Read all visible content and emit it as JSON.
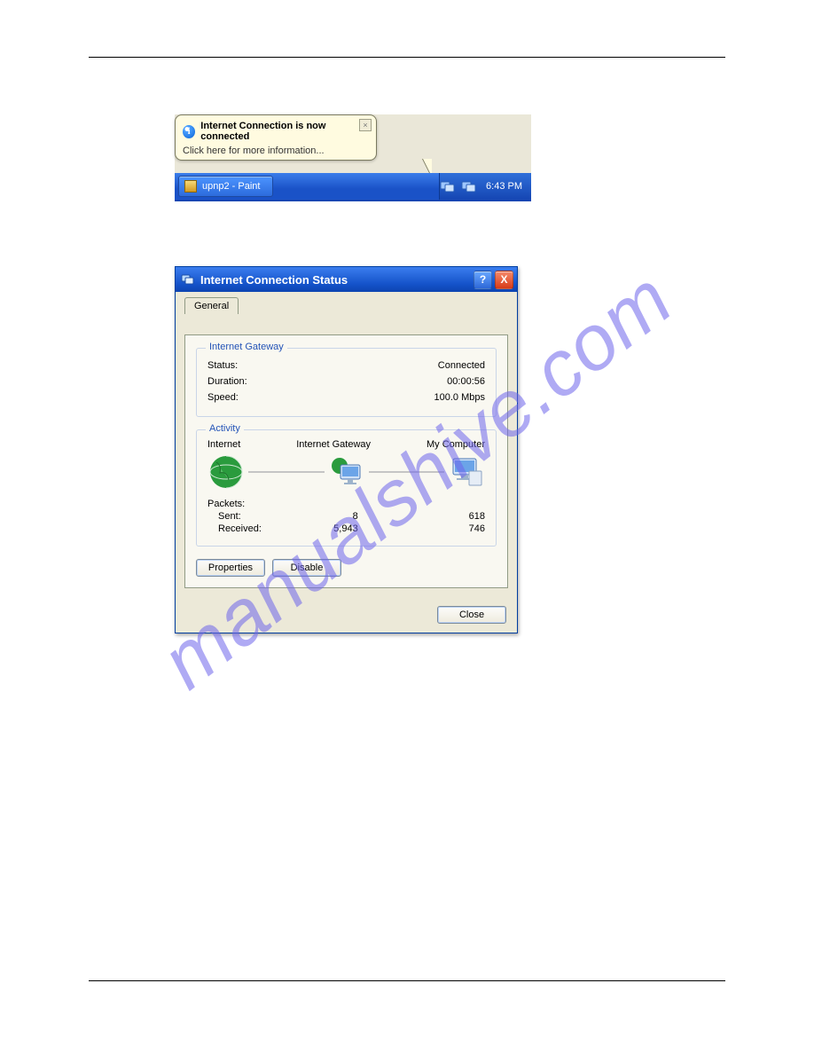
{
  "balloon": {
    "title": "Internet Connection is now connected",
    "subtitle": "Click here for more information..."
  },
  "taskbar": {
    "task_label": "upnp2 - Paint",
    "clock": "6:43 PM"
  },
  "dialog": {
    "title": "Internet Connection Status",
    "tab_general": "General",
    "gateway": {
      "legend": "Internet Gateway",
      "status_label": "Status:",
      "status_value": "Connected",
      "duration_label": "Duration:",
      "duration_value": "00:00:56",
      "speed_label": "Speed:",
      "speed_value": "100.0 Mbps"
    },
    "activity": {
      "legend": "Activity",
      "col_internet": "Internet",
      "col_gateway": "Internet Gateway",
      "col_mycomputer": "My Computer",
      "packets_label": "Packets:",
      "sent_label": "Sent:",
      "received_label": "Received:",
      "sent_internet": "8",
      "sent_mycomputer": "618",
      "recv_internet": "5,943",
      "recv_mycomputer": "746"
    },
    "buttons": {
      "properties": "Properties",
      "disable": "Disable",
      "close": "Close"
    }
  },
  "watermark": "manualshive.com"
}
